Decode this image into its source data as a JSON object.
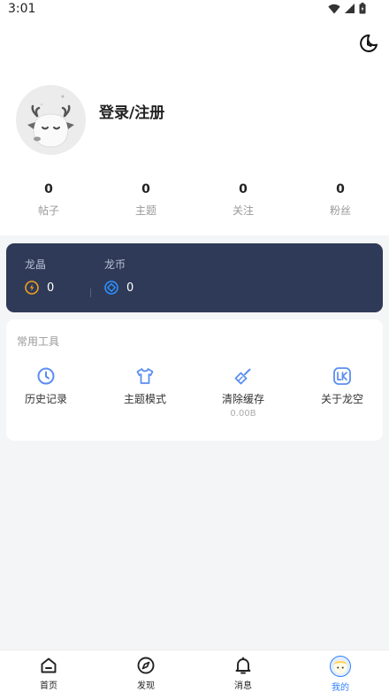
{
  "status_bar": {
    "time": "3:01"
  },
  "profile": {
    "login_label": "登录/注册"
  },
  "stats": [
    {
      "value": "0",
      "label": "帖子"
    },
    {
      "value": "0",
      "label": "主题"
    },
    {
      "value": "0",
      "label": "关注"
    },
    {
      "value": "0",
      "label": "粉丝"
    }
  ],
  "wallet": {
    "crystal": {
      "label": "龙晶",
      "value": "0",
      "icon": "crystal-coin-icon",
      "color": "#f0a020"
    },
    "coin": {
      "label": "龙币",
      "value": "0",
      "icon": "dragon-coin-icon",
      "color": "#2f8fff"
    }
  },
  "tools": {
    "title": "常用工具",
    "items": [
      {
        "label": "历史记录",
        "icon": "clock-icon"
      },
      {
        "label": "主题模式",
        "icon": "tshirt-icon"
      },
      {
        "label": "清除缓存",
        "icon": "broom-icon",
        "sub": "0.00B"
      },
      {
        "label": "关于龙空",
        "icon": "lk-logo-icon"
      }
    ]
  },
  "tabbar": [
    {
      "label": "首页",
      "icon": "home-icon"
    },
    {
      "label": "发现",
      "icon": "compass-icon"
    },
    {
      "label": "消息",
      "icon": "bell-icon"
    },
    {
      "label": "我的",
      "icon": "avatar-icon",
      "active": true
    }
  ],
  "colors": {
    "accent": "#2f7fff",
    "wallet_bg": "#2e3a57",
    "page_bg": "#f4f5f7"
  }
}
